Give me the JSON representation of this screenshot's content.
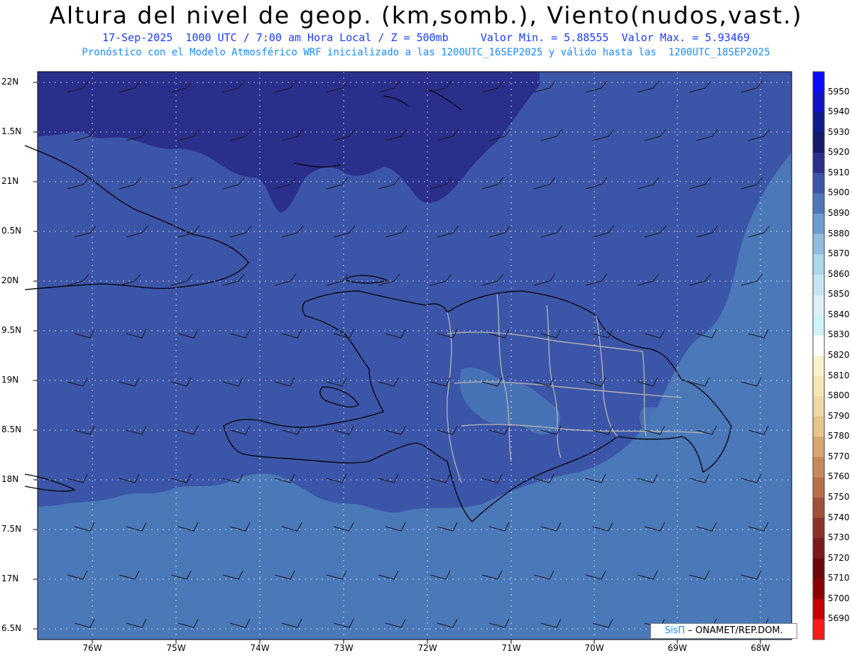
{
  "header": {
    "title": "Altura del nivel de geop. (km,somb.), Viento(nudos,vast.)",
    "line1": "17-Sep-2025  1000 UTC / 7:00 am Hora Local / Z = 500mb     Valor Min. = 5.88555  Valor Max. = 5.93469",
    "line2": "Pronóstico con el Modelo Atmosférico WRF inicializado a las 1200UTC_16SEP2025 y válido hasta las  1200UTC_18SEP2025"
  },
  "axes": {
    "lat_labels": [
      "22N",
      "1.5N",
      "21N",
      "0.5N",
      "20N",
      "9.5N",
      "19N",
      "8.5N",
      "18N",
      "7.5N",
      "17N",
      "6.5N"
    ],
    "lon_labels": [
      "76W",
      "75W",
      "74W",
      "73W",
      "72W",
      "71W",
      "70W",
      "69W",
      "68W"
    ]
  },
  "colorbar": {
    "labels": [
      "5950",
      "5940",
      "5930",
      "5920",
      "5910",
      "5900",
      "5890",
      "5880",
      "5870",
      "5860",
      "5850",
      "5840",
      "5830",
      "5820",
      "5810",
      "5800",
      "5790",
      "5780",
      "5770",
      "5760",
      "5750",
      "5740",
      "5730",
      "5720",
      "5710",
      "5700",
      "5690"
    ],
    "colors": [
      "#0a0aff",
      "#0f13c8",
      "#0c1c8c",
      "#141a6c",
      "#2a2f8c",
      "#3b55a8",
      "#4a78b8",
      "#6a9ccf",
      "#8dbde0",
      "#a9d7eb",
      "#c4e6f3",
      "#dceff8",
      "#cdf3f8",
      "#ffffff",
      "#fbf3c8",
      "#f6e6b3",
      "#efd8a4",
      "#e6c48c",
      "#d8a66e",
      "#c8895a",
      "#b86f48",
      "#a25138",
      "#8a3228",
      "#7a1a1a",
      "#6b0808",
      "#8c0000",
      "#c80000",
      "#ff1a1a"
    ]
  },
  "credit": {
    "logo": "SisΠ",
    "text": "– ONAMET/REP.DOM."
  }
}
